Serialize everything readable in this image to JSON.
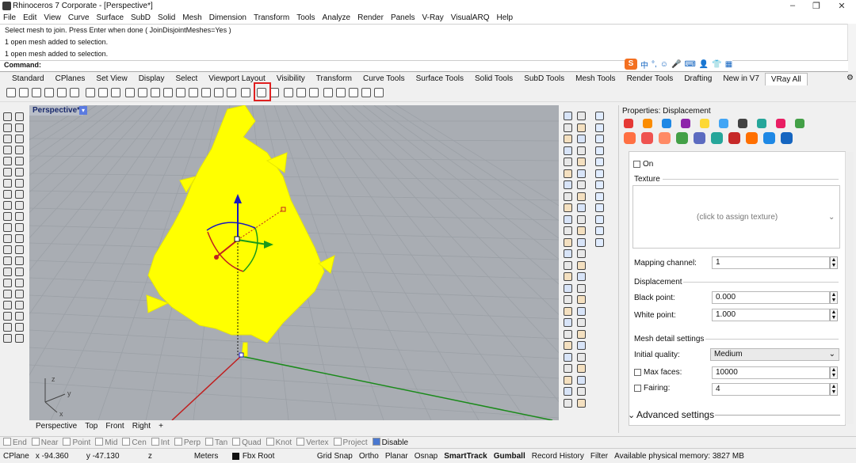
{
  "window": {
    "title": "Rhinoceros 7 Corporate - [Perspective*]",
    "controls": [
      "–",
      "❐",
      "✕"
    ]
  },
  "menu": [
    "File",
    "Edit",
    "View",
    "Curve",
    "Surface",
    "SubD",
    "Solid",
    "Mesh",
    "Dimension",
    "Transform",
    "Tools",
    "Analyze",
    "Render",
    "Panels",
    "V-Ray",
    "VisualARQ",
    "Help"
  ],
  "command_history": [
    "Select mesh to join. Press Enter when done ( JoinDisjointMeshes=Yes )",
    "1 open mesh added to selection.",
    "1 open mesh added to selection."
  ],
  "command_prompt": "Command:",
  "ime": {
    "logo": "S",
    "lang": "中"
  },
  "tabs": [
    "Standard",
    "CPlanes",
    "Set View",
    "Display",
    "Select",
    "Viewport Layout",
    "Visibility",
    "Transform",
    "Curve Tools",
    "Surface Tools",
    "Solid Tools",
    "SubD Tools",
    "Mesh Tools",
    "Render Tools",
    "Drafting",
    "New in V7",
    "VRay All"
  ],
  "active_tab": "VRay All",
  "viewport": {
    "label": "Perspective*",
    "colors": {
      "background": "#a9adb3",
      "grid": "#9aa0a6",
      "object": "#ffff00",
      "x_axis": "#c02020",
      "y_axis": "#1a8a1a"
    }
  },
  "viewport_tabs": [
    "Perspective",
    "Top",
    "Front",
    "Right",
    "+"
  ],
  "properties": {
    "title": "Properties: Displacement",
    "on_label": "On",
    "texture_label": "Texture",
    "texture_placeholder": "(click to assign texture)",
    "mapping_channel_label": "Mapping channel:",
    "mapping_channel_value": "1",
    "displacement_header": "Displacement",
    "black_point_label": "Black point:",
    "black_point_value": "0.000",
    "white_point_label": "White point:",
    "white_point_value": "1.000",
    "mesh_detail_header": "Mesh detail settings",
    "initial_quality_label": "Initial quality:",
    "initial_quality_value": "Medium",
    "max_faces_label": "Max faces:",
    "max_faces_value": "10000",
    "fairing_label": "Fairing:",
    "fairing_value": "4",
    "advanced_label": "Advanced settings"
  },
  "osnaps": [
    "End",
    "Near",
    "Point",
    "Mid",
    "Cen",
    "Int",
    "Perp",
    "Tan",
    "Quad",
    "Knot",
    "Vertex",
    "Project",
    "Disable"
  ],
  "status": {
    "cplane": "CPlane",
    "x": "x -94.360",
    "y": "y -47.130",
    "z": "z",
    "units": "Meters",
    "layer": "Fbx Root",
    "grid_snap": "Grid Snap",
    "ortho": "Ortho",
    "planar": "Planar",
    "osnap": "Osnap",
    "smarttrack": "SmartTrack",
    "gumball": "Gumball",
    "record": "Record History",
    "filter": "Filter",
    "memory": "Available physical memory: 3827 MB"
  }
}
